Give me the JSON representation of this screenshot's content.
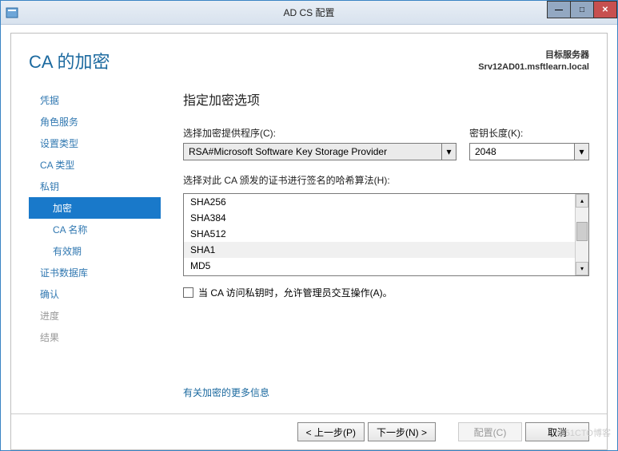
{
  "window": {
    "title": "AD CS 配置"
  },
  "header": {
    "page_title": "CA 的加密",
    "target_label": "目标服务器",
    "target_name": "Srv12AD01.msftlearn.local"
  },
  "sidebar": {
    "items": [
      {
        "label": "凭据",
        "indent": false,
        "active": false,
        "disabled": false
      },
      {
        "label": "角色服务",
        "indent": false,
        "active": false,
        "disabled": false
      },
      {
        "label": "设置类型",
        "indent": false,
        "active": false,
        "disabled": false
      },
      {
        "label": "CA 类型",
        "indent": false,
        "active": false,
        "disabled": false
      },
      {
        "label": "私钥",
        "indent": false,
        "active": false,
        "disabled": false
      },
      {
        "label": "加密",
        "indent": true,
        "active": true,
        "disabled": false
      },
      {
        "label": "CA 名称",
        "indent": true,
        "active": false,
        "disabled": false
      },
      {
        "label": "有效期",
        "indent": true,
        "active": false,
        "disabled": false
      },
      {
        "label": "证书数据库",
        "indent": false,
        "active": false,
        "disabled": false
      },
      {
        "label": "确认",
        "indent": false,
        "active": false,
        "disabled": false
      },
      {
        "label": "进度",
        "indent": false,
        "active": false,
        "disabled": true
      },
      {
        "label": "结果",
        "indent": false,
        "active": false,
        "disabled": true
      }
    ]
  },
  "form": {
    "heading": "指定加密选项",
    "csp_label": "选择加密提供程序(C):",
    "csp_value": "RSA#Microsoft Software Key Storage Provider",
    "keylen_label": "密钥长度(K):",
    "keylen_value": "2048",
    "hash_label": "选择对此 CA 颁发的证书进行签名的哈希算法(H):",
    "hash_options": [
      "SHA256",
      "SHA384",
      "SHA512",
      "SHA1",
      "MD5"
    ],
    "hash_selected": "SHA1",
    "checkbox_label": "当 CA 访问私钥时，允许管理员交互操作(A)。",
    "more_link": "有关加密的更多信息"
  },
  "buttons": {
    "prev": "< 上一步(P)",
    "next": "下一步(N) >",
    "configure": "配置(C)",
    "cancel": "取消"
  },
  "watermark": "@51CTO博客"
}
